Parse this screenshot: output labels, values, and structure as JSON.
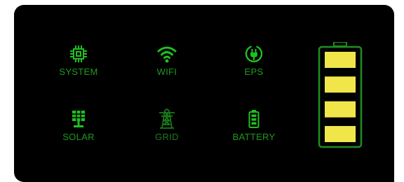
{
  "colors": {
    "panel_bg": "#000000",
    "icon_active": "#1fbf1f",
    "icon_dim": "#1a7a1a",
    "battery_outline": "#1f8f1f",
    "battery_cell": "#f0e64a"
  },
  "indicators": [
    {
      "id": "system",
      "label": "SYSTEM",
      "icon": "chip-icon",
      "active": true
    },
    {
      "id": "wifi",
      "label": "WIFI",
      "icon": "wifi-icon",
      "active": true
    },
    {
      "id": "eps",
      "label": "EPS",
      "icon": "plug-icon",
      "active": true
    },
    {
      "id": "solar",
      "label": "SOLAR",
      "icon": "solar-panel-icon",
      "active": true
    },
    {
      "id": "grid",
      "label": "GRID",
      "icon": "power-tower-icon",
      "active": false
    },
    {
      "id": "battery",
      "label": "BATTERY",
      "icon": "battery-icon",
      "active": true
    }
  ],
  "battery_gauge": {
    "cells_total": 4,
    "cells_filled": 4,
    "level_fraction": 1.0
  }
}
